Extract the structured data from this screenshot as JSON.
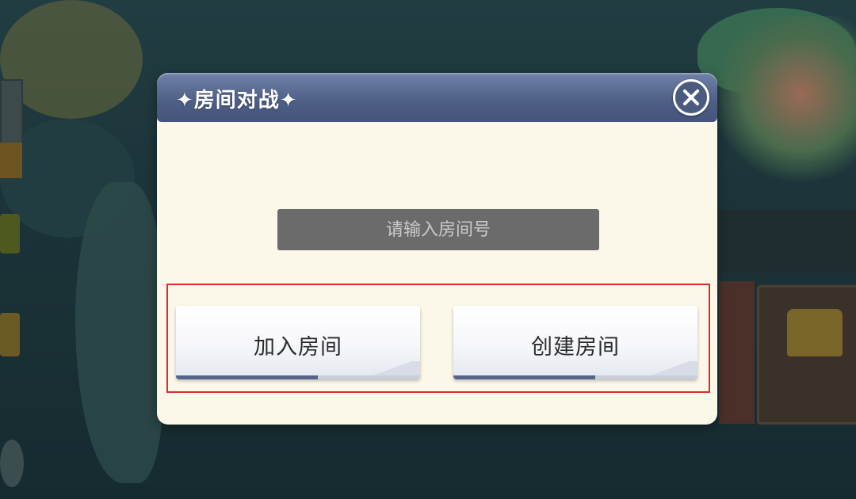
{
  "dialog": {
    "title": "✦房间对战✦",
    "close_icon": "close-icon",
    "room_input": {
      "value": "",
      "placeholder": "请输入房间号"
    },
    "join_button": {
      "label": "加入房间"
    },
    "create_button": {
      "label": "创建房间"
    }
  },
  "colors": {
    "header": "#4e5f86",
    "dialog_bg": "#fbf8ea",
    "input_bg": "#6b6b6b",
    "highlight": "#e02a2a"
  }
}
